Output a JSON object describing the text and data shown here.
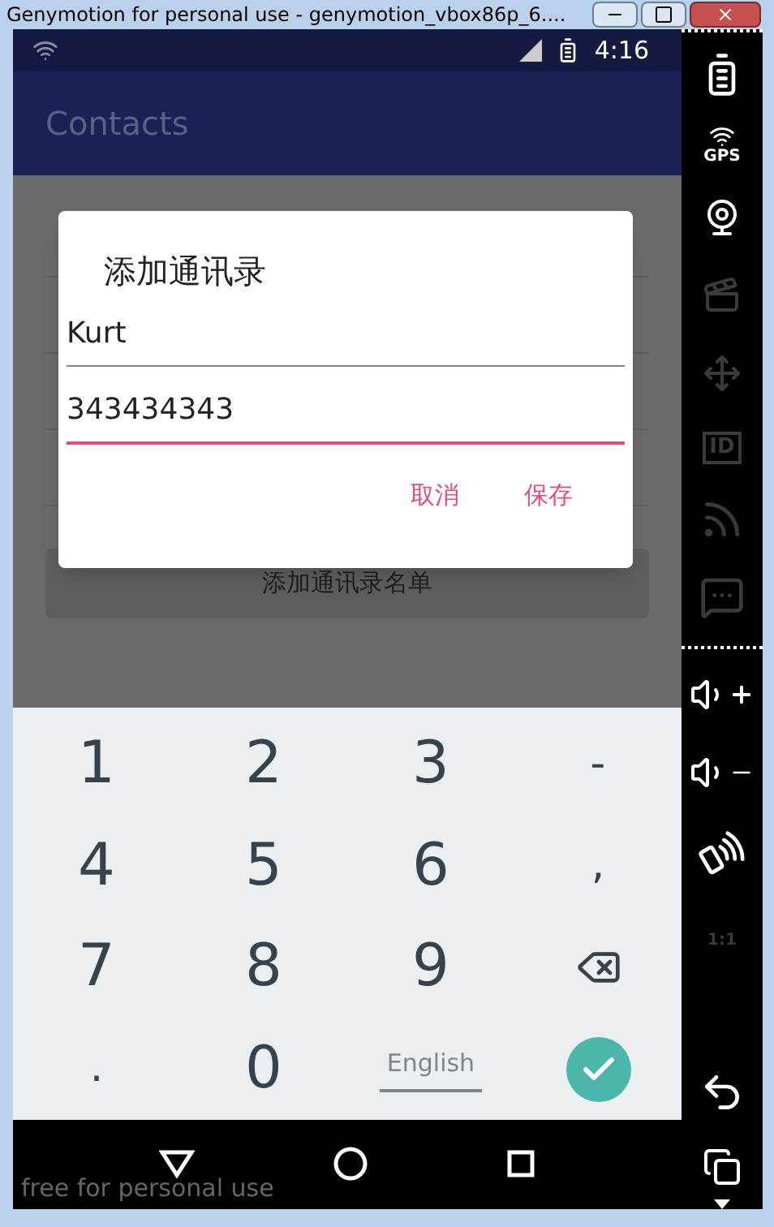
{
  "window": {
    "title": "Genymotion for personal use - genymotion_vbox86p_6...."
  },
  "status_bar": {
    "time": "4:16"
  },
  "app_bar": {
    "title": "Contacts"
  },
  "add_button": "添加通讯录名单",
  "dialog": {
    "title": "添加通讯录",
    "fields": [
      {
        "value": "Kurt",
        "focused": false
      },
      {
        "value": "343434343",
        "focused": true
      }
    ],
    "buttons": [
      "取消",
      "保存"
    ]
  },
  "keyboard": {
    "keys": [
      {
        "kind": "digit",
        "label": "1"
      },
      {
        "kind": "digit",
        "label": "2"
      },
      {
        "kind": "digit",
        "label": "3"
      },
      {
        "kind": "symbol",
        "label": "-"
      },
      {
        "kind": "digit",
        "label": "4"
      },
      {
        "kind": "digit",
        "label": "5"
      },
      {
        "kind": "digit",
        "label": "6"
      },
      {
        "kind": "symbol",
        "label": ","
      },
      {
        "kind": "digit",
        "label": "7"
      },
      {
        "kind": "digit",
        "label": "8"
      },
      {
        "kind": "digit",
        "label": "9"
      },
      {
        "kind": "backspace"
      },
      {
        "kind": "symbol",
        "label": "."
      },
      {
        "kind": "digit",
        "label": "0"
      },
      {
        "kind": "language",
        "label": "English"
      },
      {
        "kind": "done"
      }
    ]
  },
  "overlay_text": "free for personal use",
  "side_panel": [
    {
      "kind": "battery",
      "disabled": false
    },
    {
      "kind": "gps",
      "label": "GPS",
      "disabled": false
    },
    {
      "kind": "camera",
      "disabled": false
    },
    {
      "kind": "capture",
      "disabled": true
    },
    {
      "kind": "dpad",
      "disabled": true
    },
    {
      "kind": "id",
      "label": "ID",
      "disabled": true
    },
    {
      "kind": "network",
      "disabled": true
    },
    {
      "kind": "sms",
      "disabled": true
    },
    {
      "kind": "divider"
    },
    {
      "kind": "volume_up",
      "disabled": false
    },
    {
      "kind": "volume_down",
      "disabled": false
    },
    {
      "kind": "rotate",
      "disabled": false
    },
    {
      "kind": "scale",
      "label": "1:1",
      "disabled": true
    },
    {
      "kind": "spacer"
    },
    {
      "kind": "back",
      "disabled": false
    },
    {
      "kind": "recents",
      "disabled": false
    },
    {
      "kind": "more",
      "disabled": false
    }
  ]
}
